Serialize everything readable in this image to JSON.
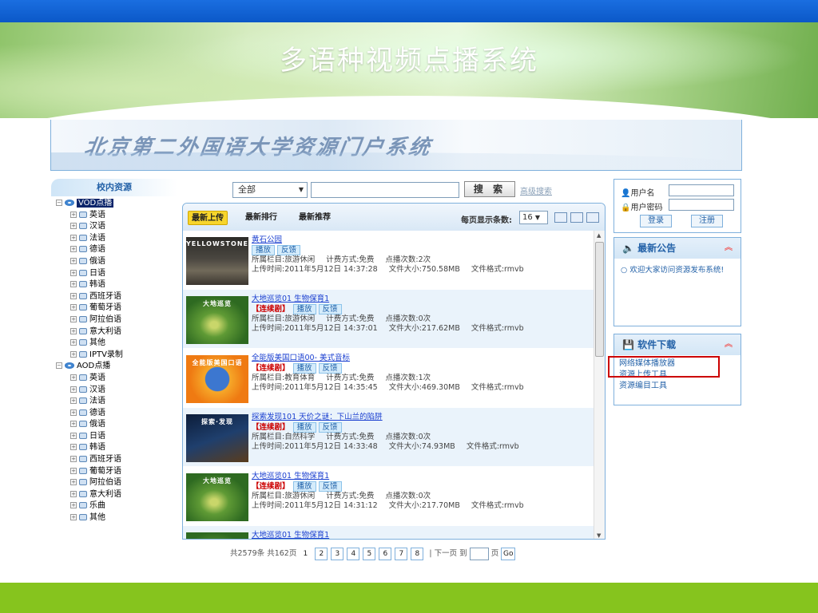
{
  "banner": {
    "title": "多语种视频点播系统"
  },
  "portal": {
    "title": "北京第二外国语大学资源门户系统"
  },
  "left": {
    "header": "校内资源",
    "vod_label": "VOD点播",
    "vod_items": [
      "英语",
      "汉语",
      "法语",
      "德语",
      "俄语",
      "日语",
      "韩语",
      "西班牙语",
      "葡萄牙语",
      "阿拉伯语",
      "意大利语",
      "其他",
      "IPTV录制"
    ],
    "aod_label": "AOD点播",
    "aod_items": [
      "英语",
      "汉语",
      "法语",
      "德语",
      "俄语",
      "日语",
      "韩语",
      "西班牙语",
      "葡萄牙语",
      "阿拉伯语",
      "意大利语",
      "乐曲",
      "其他"
    ]
  },
  "search": {
    "scope": "全部",
    "button": "搜 索",
    "advanced": "高级搜索"
  },
  "tabs": {
    "latest_upload": "最新上传",
    "latest_rank": "最新排行",
    "latest_recommend": "最新推荐"
  },
  "perpage": {
    "label": "每页显示条数:",
    "value": "16"
  },
  "items": [
    {
      "title": "黄石公园",
      "series": "",
      "play": "播放",
      "feedback": "反馈",
      "category": "所属栏目:旅游休闲",
      "fee": "计费方式:免费",
      "plays": "点播次数:2次",
      "uploaded": "上传时间:2011年5月12日 14:37:28",
      "size": "文件大小:750.58MB",
      "format": "文件格式:rmvb",
      "thumb_text": "YELLOWSTONE"
    },
    {
      "title": "大地巡览01 生物保育1",
      "series": "【连续剧】",
      "play": "播放",
      "feedback": "反馈",
      "category": "所属栏目:旅游休闲",
      "fee": "计费方式:免费",
      "plays": "点播次数:0次",
      "uploaded": "上传时间:2011年5月12日 14:37:01",
      "size": "文件大小:217.62MB",
      "format": "文件格式:rmvb",
      "thumb_text": "大地巡览"
    },
    {
      "title": "全能版美国口语00- 美式音标",
      "series": "【连续剧】",
      "play": "播放",
      "feedback": "反馈",
      "category": "所属栏目:教育体育",
      "fee": "计费方式:免费",
      "plays": "点播次数:1次",
      "uploaded": "上传时间:2011年5月12日 14:35:45",
      "size": "文件大小:469.30MB",
      "format": "文件格式:rmvb",
      "thumb_text": "全能版美国口语"
    },
    {
      "title": "探索发现101 天价之谜：下山兰的陷阱",
      "series": "【连续剧】",
      "play": "播放",
      "feedback": "反馈",
      "category": "所属栏目:自然科学",
      "fee": "计费方式:免费",
      "plays": "点播次数:0次",
      "uploaded": "上传时间:2011年5月12日 14:33:48",
      "size": "文件大小:74.93MB",
      "format": "文件格式:rmvb",
      "thumb_text": "探索·发现"
    },
    {
      "title": "大地巡览01 生物保育1",
      "series": "【连续剧】",
      "play": "播放",
      "feedback": "反馈",
      "category": "所属栏目:旅游休闲",
      "fee": "计费方式:免费",
      "plays": "点播次数:0次",
      "uploaded": "上传时间:2011年5月12日 14:31:12",
      "size": "文件大小:217.70MB",
      "format": "文件格式:rmvb",
      "thumb_text": "大地巡览"
    },
    {
      "title": "大地巡览01 生物保育1",
      "series": "",
      "play": "",
      "feedback": "",
      "category": "",
      "fee": "",
      "plays": "",
      "uploaded": "",
      "size": "",
      "format": "",
      "thumb_text": ""
    }
  ],
  "pager": {
    "summary": "共2579条 共162页",
    "current": "1",
    "pages": [
      "2",
      "3",
      "4",
      "5",
      "6",
      "7",
      "8"
    ],
    "next": "| 下一页",
    "goto": "到",
    "page": "页",
    "go": "Go"
  },
  "login": {
    "username_label": "用户名",
    "password_label": "用户密码",
    "login": "登录",
    "register": "注册"
  },
  "notice": {
    "title": "最新公告",
    "text": "欢迎大家访问资源发布系统!"
  },
  "download": {
    "title": "软件下载",
    "items": [
      "网络媒体播放器",
      "资源上传工具",
      "资源编目工具"
    ]
  }
}
